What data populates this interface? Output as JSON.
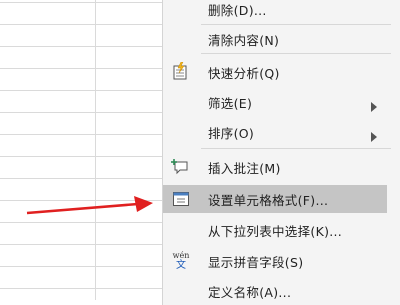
{
  "menu": {
    "items": [
      {
        "label": "删除(D)..."
      },
      {
        "label": "清除内容(N)"
      },
      {
        "label": "快速分析(Q)"
      },
      {
        "label": "筛选(E)"
      },
      {
        "label": "排序(O)"
      },
      {
        "label": "插入批注(M)"
      },
      {
        "label": "设置单元格格式(F)..."
      },
      {
        "label": "从下拉列表中选择(K)..."
      },
      {
        "label": "显示拼音字段(S)"
      },
      {
        "label": "定义名称(A)..."
      }
    ],
    "highlighted_item": "设置单元格格式(F)...",
    "phonetic_icon_text": {
      "top": "wén",
      "bottom": "文"
    }
  },
  "annotation": {
    "arrow_color": "#e02020"
  }
}
